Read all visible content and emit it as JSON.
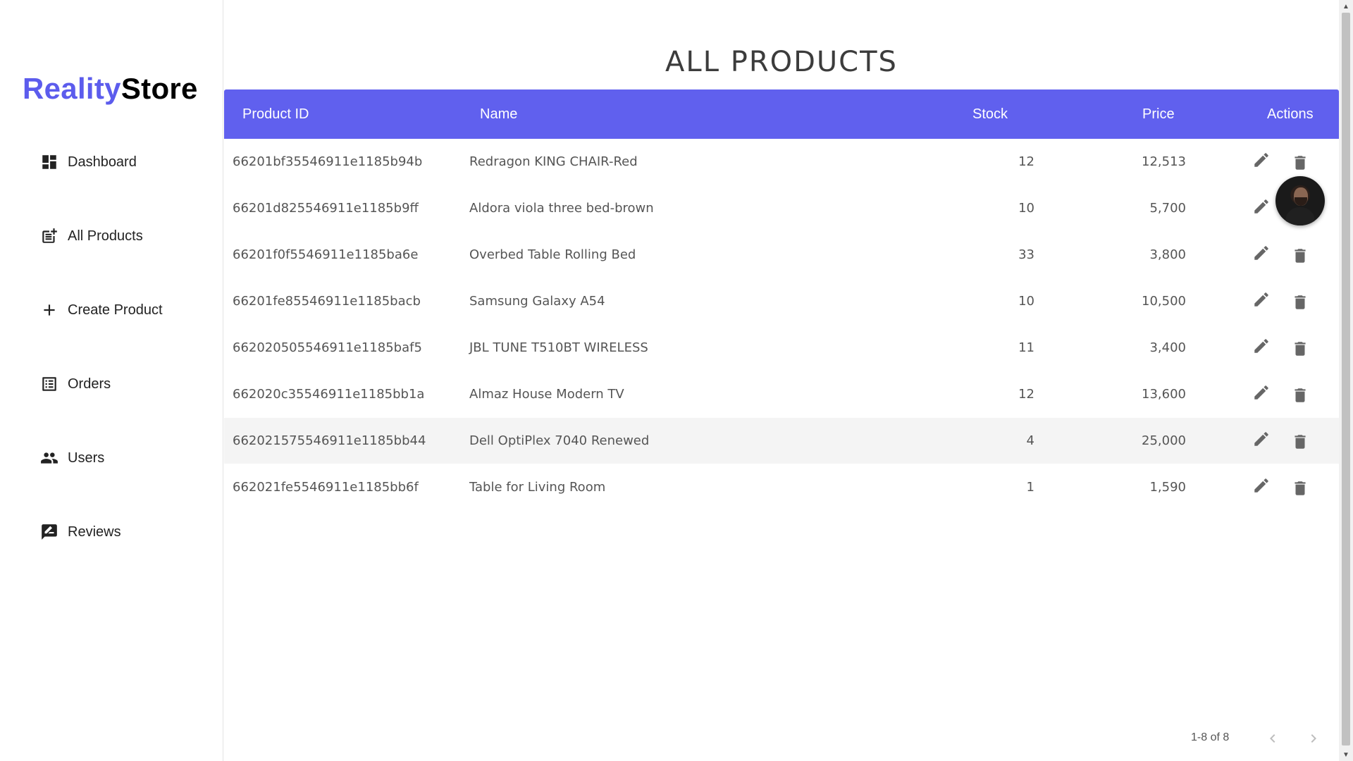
{
  "brand": {
    "part1": "Reality",
    "part2": "Store",
    "colors": {
      "part1": "#5c5ced",
      "part2": "#000000"
    }
  },
  "sidebar": {
    "items": [
      {
        "label": "Dashboard",
        "icon": "dashboard-icon"
      },
      {
        "label": "All Products",
        "icon": "post-add-icon"
      },
      {
        "label": "Create Product",
        "icon": "add-icon"
      },
      {
        "label": "Orders",
        "icon": "list-alt-icon"
      },
      {
        "label": "Users",
        "icon": "people-icon"
      },
      {
        "label": "Reviews",
        "icon": "rate-review-icon"
      }
    ]
  },
  "main": {
    "title": "ALL PRODUCTS",
    "accent_color": "#6060ee",
    "table": {
      "columns": [
        "Product ID",
        "Name",
        "Stock",
        "Price",
        "Actions"
      ],
      "rows": [
        {
          "id": "66201bf35546911e1185b94b",
          "name": "Redragon KING CHAIR-Red",
          "stock": "12",
          "price": "12,513"
        },
        {
          "id": "66201d825546911e1185b9ff",
          "name": "Aldora viola three bed-brown",
          "stock": "10",
          "price": "5,700"
        },
        {
          "id": "66201f0f5546911e1185ba6e",
          "name": "Overbed Table Rolling Bed",
          "stock": "33",
          "price": "3,800"
        },
        {
          "id": "66201fe85546911e1185bacb",
          "name": "Samsung Galaxy A54",
          "stock": "10",
          "price": "10,500"
        },
        {
          "id": "662020505546911e1185baf5",
          "name": "JBL TUNE T510BT WIRELESS",
          "stock": "11",
          "price": "3,400"
        },
        {
          "id": "662020c35546911e1185bb1a",
          "name": "Almaz House Modern TV",
          "stock": "12",
          "price": "13,600"
        },
        {
          "id": "662021575546911e1185bb44",
          "name": "Dell OptiPlex 7040 Renewed",
          "stock": "4",
          "price": "25,000"
        },
        {
          "id": "662021fe5546911e1185bb6f",
          "name": "Table for Living Room",
          "stock": "1",
          "price": "1,590"
        }
      ],
      "highlighted_row": 6,
      "actions": [
        "edit-icon",
        "delete-icon"
      ]
    },
    "pagination": {
      "info": "1-8 of 8",
      "prev_icon": "chevron-left-icon",
      "next_icon": "chevron-right-icon"
    }
  }
}
